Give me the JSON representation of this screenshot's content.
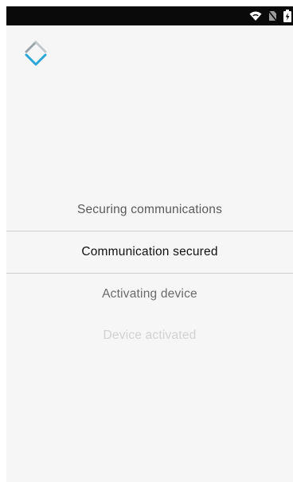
{
  "status_bar": {
    "icons": [
      "wifi-icon",
      "no-sim-icon",
      "battery-icon"
    ],
    "background_color": "#0a0a0a"
  },
  "app": {
    "logo_icon": "diamond-logo-icon",
    "logo_accent_color": "#2aa7d8"
  },
  "activation_steps": [
    {
      "label": "Securing communications",
      "state": "done"
    },
    {
      "label": "Communication secured",
      "state": "current"
    },
    {
      "label": "Activating device",
      "state": "pending"
    },
    {
      "label": "Device activated",
      "state": "upcoming"
    }
  ]
}
